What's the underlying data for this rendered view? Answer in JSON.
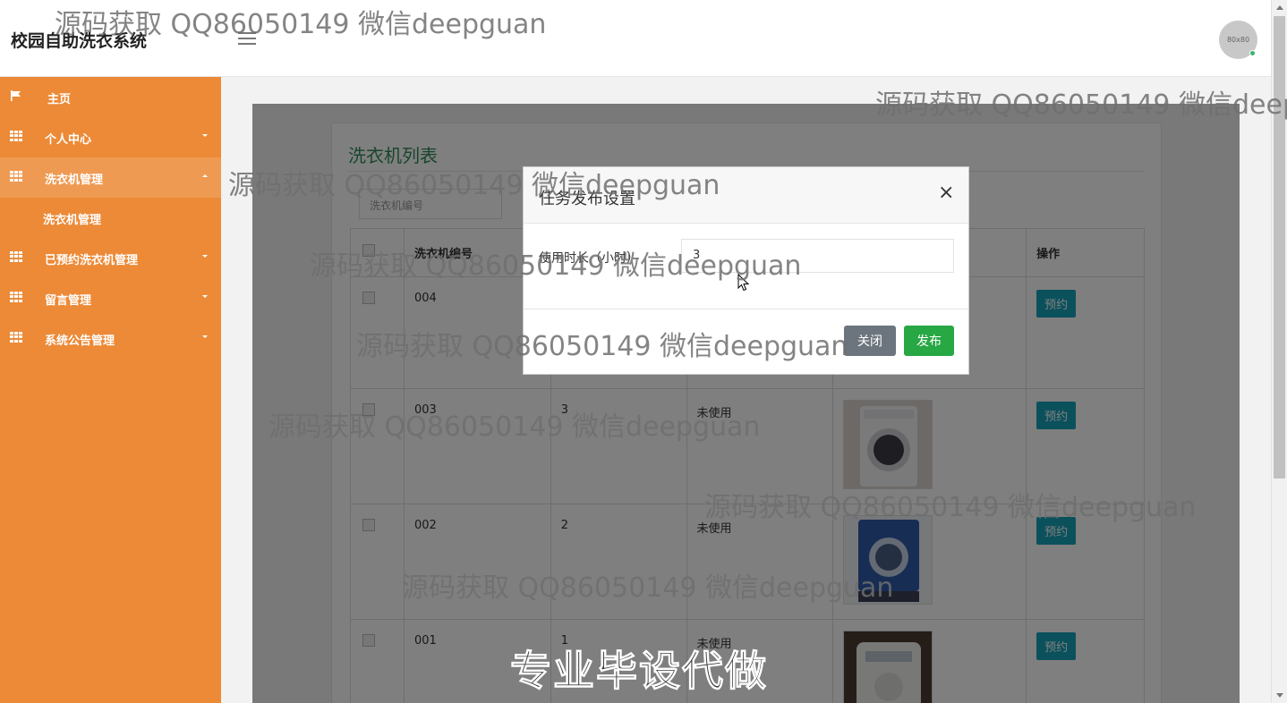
{
  "header": {
    "brand": "校园自助洗衣系统",
    "avatar_text": "80x80"
  },
  "sidebar": {
    "items": [
      {
        "label": "主页",
        "icon": "flag-icon"
      },
      {
        "label": "个人中心",
        "icon": "grid-icon"
      },
      {
        "label": "洗衣机管理",
        "icon": "grid-icon"
      },
      {
        "label": "已预约洗衣机管理",
        "icon": "grid-icon"
      },
      {
        "label": "留言管理",
        "icon": "grid-icon"
      },
      {
        "label": "系统公告管理",
        "icon": "grid-icon"
      }
    ],
    "sub_item": "洗衣机管理"
  },
  "panel": {
    "title": "洗衣机列表",
    "search_placeholder": "洗衣机编号"
  },
  "table": {
    "headers": [
      "洗衣机编号",
      "操作"
    ],
    "rows": [
      {
        "code": "004",
        "name": "",
        "status": "",
        "action": "预约"
      },
      {
        "code": "003",
        "name": "3",
        "status": "未使用",
        "action": "预约"
      },
      {
        "code": "002",
        "name": "2",
        "status": "未使用",
        "action": "预约"
      },
      {
        "code": "001",
        "name": "1",
        "status": "未使用",
        "action": "预约"
      }
    ]
  },
  "modal": {
    "title": "任务发布设置",
    "close_symbol": "×",
    "field_label": "使用时长（小时）",
    "field_value": "3",
    "btn_close": "关闭",
    "btn_publish": "发布"
  },
  "watermarks": {
    "text": "源码获取 QQ86050149 微信deepguan",
    "text_cut": "源码获取 QQ86050149 微信deep",
    "big": "专业毕设代做"
  },
  "colors": {
    "sidebar": "#ec8a37",
    "sidebar_active": "#ef9a52",
    "title_green": "#2e8b57",
    "button_teal": "#17a2b8",
    "button_green": "#28a745",
    "button_gray": "#6c757d"
  }
}
